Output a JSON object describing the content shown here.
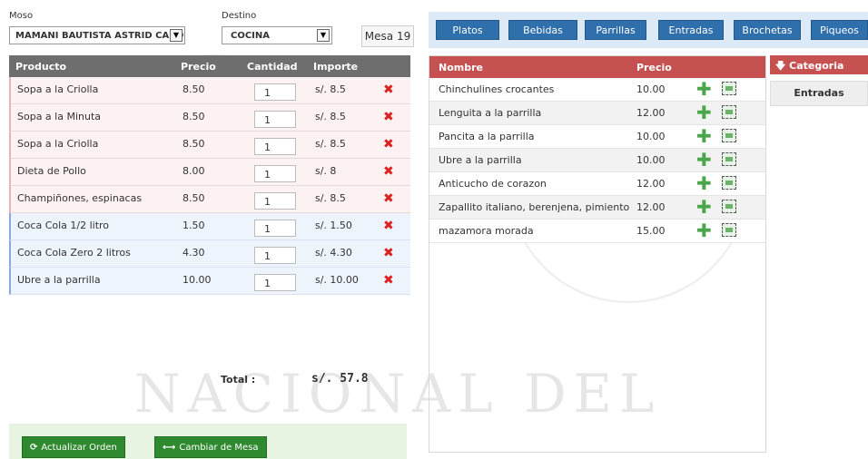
{
  "order_form": {
    "waiter_label": "Moso",
    "waiter_value": "MAMANI BAUTISTA ASTRID CARO",
    "destination_label": "Destino",
    "destination_value": "COCINA",
    "table_label": "Mesa 19"
  },
  "order_table": {
    "headers": {
      "product": "Producto",
      "price": "Precio",
      "quantity": "Cantidad",
      "amount": "Importe"
    },
    "rows": [
      {
        "product": "Sopa a la Criolla",
        "price": "8.50",
        "qty": "1",
        "amount": "s/. 8.5",
        "type": "food"
      },
      {
        "product": "Sopa a la Minuta",
        "price": "8.50",
        "qty": "1",
        "amount": "s/. 8.5",
        "type": "food"
      },
      {
        "product": "Sopa a la Criolla",
        "price": "8.50",
        "qty": "1",
        "amount": "s/. 8.5",
        "type": "food"
      },
      {
        "product": "Dieta de Pollo",
        "price": "8.00",
        "qty": "1",
        "amount": "s/. 8",
        "type": "food"
      },
      {
        "product": "Champiñones, espinacas",
        "price": "8.50",
        "qty": "1",
        "amount": "s/. 8.5",
        "type": "food"
      },
      {
        "product": "Coca Cola 1/2 litro",
        "price": "1.50",
        "qty": "1",
        "amount": "s/. 1.50",
        "type": "drink"
      },
      {
        "product": "Coca Cola Zero 2 litros",
        "price": "4.30",
        "qty": "1",
        "amount": "s/. 4.30",
        "type": "drink"
      },
      {
        "product": "Ubre a la parrilla",
        "price": "10.00",
        "qty": "1",
        "amount": "s/. 10.00",
        "type": "drink"
      }
    ],
    "delete_icon": "close-icon",
    "delete_color": "#d22222"
  },
  "total": {
    "label": "Total :",
    "value": "s/. 57.8"
  },
  "actions": {
    "update_label": "Actualizar Orden",
    "update_icon": "refresh-icon",
    "change_table_label": "Cambiar de Mesa",
    "change_table_icon": "swap-arrows-icon",
    "button_color": "#2f8a2f"
  },
  "category_tabs": [
    "Platos",
    "Bebidas",
    "Parrillas",
    "Entradas",
    "Brochetas",
    "Piqueos"
  ],
  "product_list": {
    "headers": {
      "name": "Nombre",
      "price": "Precio"
    },
    "rows": [
      {
        "name": "Chinchulines crocantes",
        "price": "10.00"
      },
      {
        "name": "Lenguita a la parrilla",
        "price": "12.00"
      },
      {
        "name": "Pancita a la parrilla",
        "price": "10.00"
      },
      {
        "name": "Ubre a la parrilla",
        "price": "10.00"
      },
      {
        "name": "Anticucho de corazon",
        "price": "12.00"
      },
      {
        "name": "Zapallito italiano, berenjena, pimiento",
        "price": "12.00"
      },
      {
        "name": "mazamora morada",
        "price": "15.00"
      }
    ],
    "add_icon": "plus-icon",
    "image_icon": "image-icon",
    "header_color": "#c55250"
  },
  "category_panel": {
    "header": "Categoria",
    "header_icon": "arrow-down-icon",
    "selected": "Entradas"
  },
  "watermark": "NACIONAL DEL"
}
